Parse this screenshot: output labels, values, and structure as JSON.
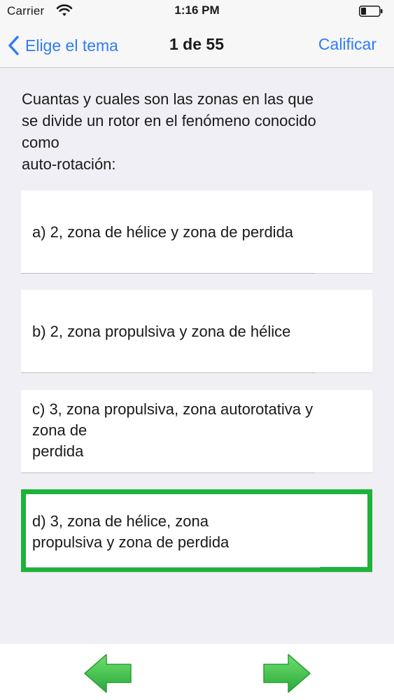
{
  "status_bar": {
    "carrier": "Carrier",
    "time": "1:16 PM"
  },
  "nav": {
    "back_label": "Elige el tema",
    "title": "1 de 55",
    "grade_label": "Calificar"
  },
  "question": {
    "text": "Cuantas y cuales son las zonas en las que\nse divide un rotor en el fenómeno conocido\ncomo\nauto-rotación:"
  },
  "answers": [
    {
      "text": "a) 2, zona de hélice y zona de perdida",
      "selected": false
    },
    {
      "text": "b) 2, zona propulsiva y zona de hélice",
      "selected": false
    },
    {
      "text": "c) 3, zona propulsiva, zona autorotativa y\nzona de\nperdida",
      "selected": false
    },
    {
      "text": "d) 3, zona de hélice, zona\npropulsiva y zona de perdida",
      "selected": true
    }
  ],
  "colors": {
    "accent_blue": "#2f7cf6",
    "selected_border": "#1db33a",
    "arrow_green": "#39c54a"
  },
  "icons": {
    "prev": "arrow-left-icon",
    "next": "arrow-right-icon"
  }
}
